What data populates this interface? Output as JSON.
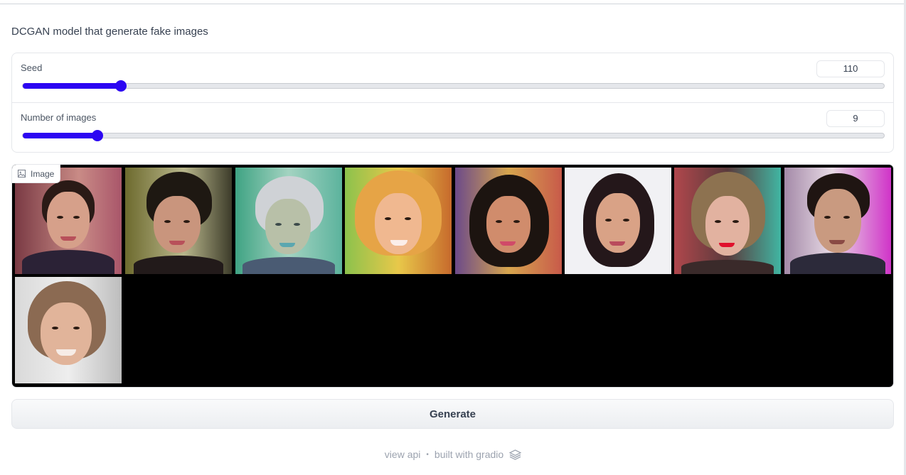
{
  "description": "DCGAN model that generate fake images",
  "sliders": [
    {
      "label": "Seed",
      "value": "110",
      "fill_fraction": 0.114
    },
    {
      "label": "Number of images",
      "value": "9",
      "fill_fraction": 0.087
    }
  ],
  "gallery": {
    "label": "Image",
    "label_icon": "image-icon",
    "image_count": 9
  },
  "generate_button": {
    "label": "Generate"
  },
  "footer": {
    "view_api": "view api",
    "separator": "•",
    "built_with": "built with gradio",
    "logo_icon": "gradio-logo-icon"
  },
  "colors": {
    "accent": "#2c06f2",
    "gallery_bg": "#000000"
  }
}
